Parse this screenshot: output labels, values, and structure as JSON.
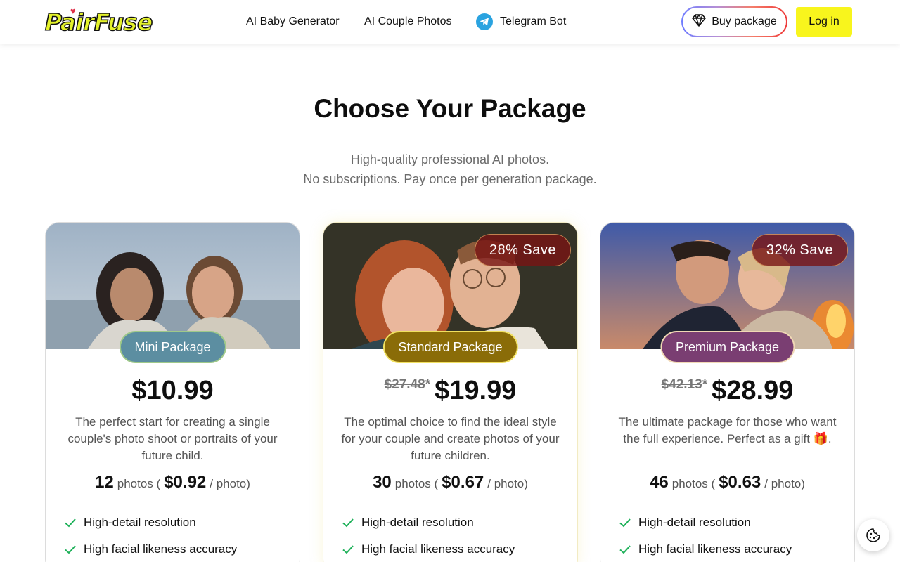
{
  "header": {
    "logo_text": "PairFuse",
    "nav": {
      "baby": "AI Baby Generator",
      "couple": "AI Couple Photos",
      "telegram": "Telegram Bot"
    },
    "buy_label": "Buy package",
    "login_label": "Log in"
  },
  "hero": {
    "title": "Choose Your Package",
    "subtitle_line1": "High-quality professional AI photos.",
    "subtitle_line2": "No subscriptions. Pay once per generation package."
  },
  "packages": [
    {
      "name": "Mini Package",
      "price": "$10.99",
      "old_price": "",
      "save": "",
      "description": "The perfect start for creating a single couple's photo shoot or portraits of your future child.",
      "photos_count": "12",
      "photos_word": "photos (",
      "per_photo_price": "$0.92",
      "per_photo_suffix": "/ photo)",
      "features": [
        "High-detail resolution",
        "High facial likeness accuracy"
      ]
    },
    {
      "name": "Standard Package",
      "price": "$19.99",
      "old_price": "$27.48",
      "old_price_mark": "*",
      "save": "28% Save",
      "description": "The optimal choice to find the ideal style for your couple and create photos of your future children.",
      "photos_count": "30",
      "photos_word": "photos (",
      "per_photo_price": "$0.67",
      "per_photo_suffix": "/ photo)",
      "features": [
        "High-detail resolution",
        "High facial likeness accuracy"
      ]
    },
    {
      "name": "Premium Package",
      "price": "$28.99",
      "old_price": "$42.13",
      "old_price_mark": "*",
      "save": "32% Save",
      "description": "The ultimate package for those who want the full experience. Perfect as a gift 🎁.",
      "photos_count": "46",
      "photos_word": "photos (",
      "per_photo_price": "$0.63",
      "per_photo_suffix": "/ photo)",
      "features": [
        "High-detail resolution",
        "High facial likeness accuracy"
      ]
    }
  ],
  "icons": {
    "telegram": "telegram-icon",
    "buy": "diamond-icon",
    "feature": "check-icon",
    "cookie": "cookie-icon"
  },
  "colors": {
    "login_bg": "#f8f51d",
    "check_green": "#1fb15a",
    "mini_badge": "#5c8ea1",
    "standard_badge": "#8a6c08",
    "premium_badge": "#7a3e72"
  }
}
